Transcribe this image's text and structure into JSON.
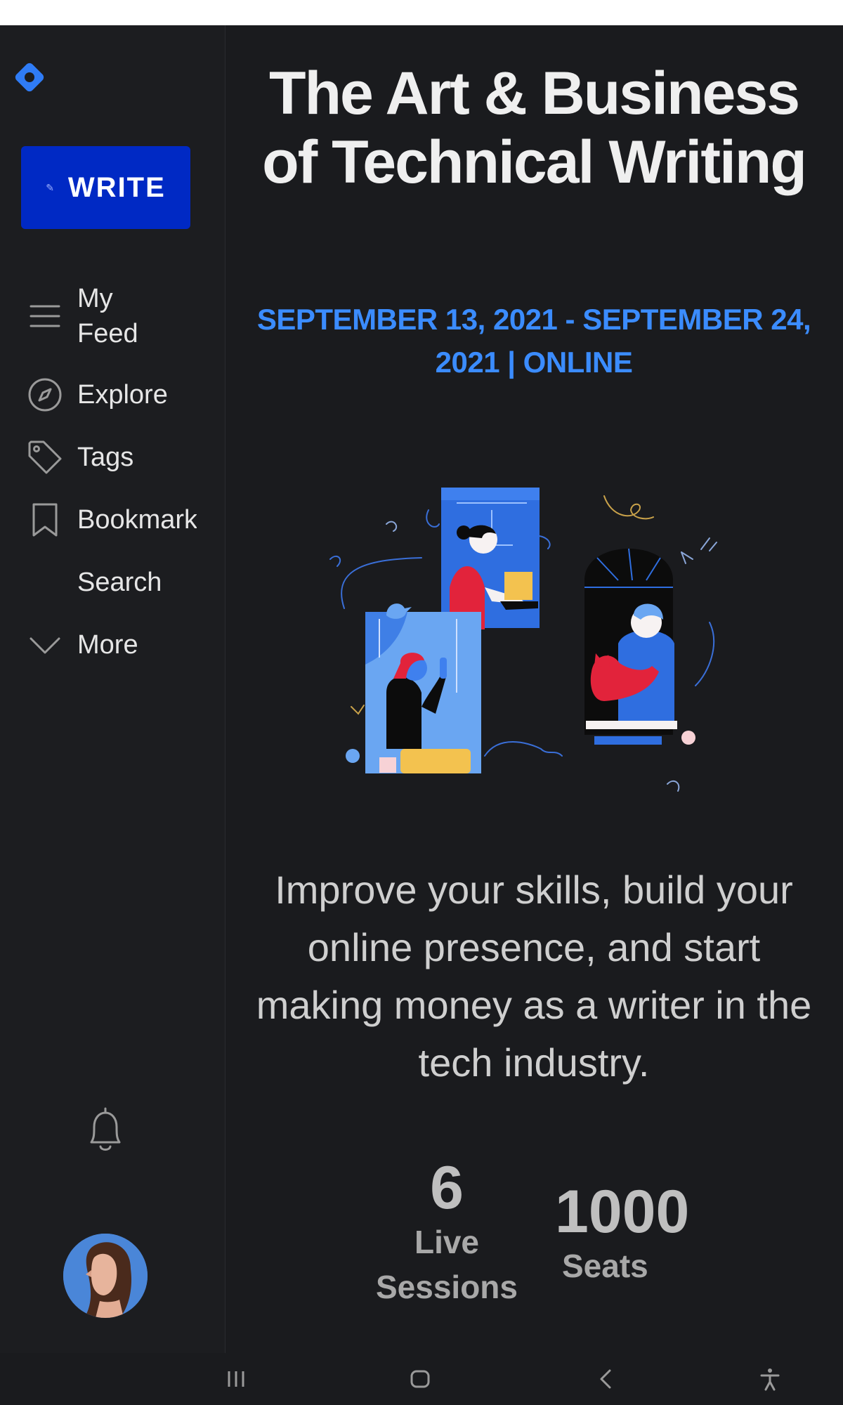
{
  "sidebar": {
    "write_label": "WRITE",
    "items": [
      {
        "label": "My Feed",
        "icon": "menu-icon"
      },
      {
        "label": "Explore",
        "icon": "compass-icon"
      },
      {
        "label": "Tags",
        "icon": "tag-icon"
      },
      {
        "label": "Bookmarks",
        "icon": "bookmark-icon"
      },
      {
        "label": "Search",
        "icon": "search-icon"
      },
      {
        "label": "More",
        "icon": "chevron-down-icon"
      }
    ]
  },
  "main": {
    "title": "The Art & Business of Technical Writing",
    "dates": "SEPTEMBER 13, 2021 - SEPTEMBER 24, 2021 | ONLINE",
    "tagline": "Improve your skills, build your online presence, and start making money as a writer in the tech industry.",
    "stats": [
      {
        "value": "6",
        "label": "Live Sessions"
      },
      {
        "value": "1000",
        "label": "Seats"
      }
    ]
  },
  "colors": {
    "accent": "#3b8cff",
    "write_button": "#0029c4",
    "background": "#1a1b1e"
  }
}
